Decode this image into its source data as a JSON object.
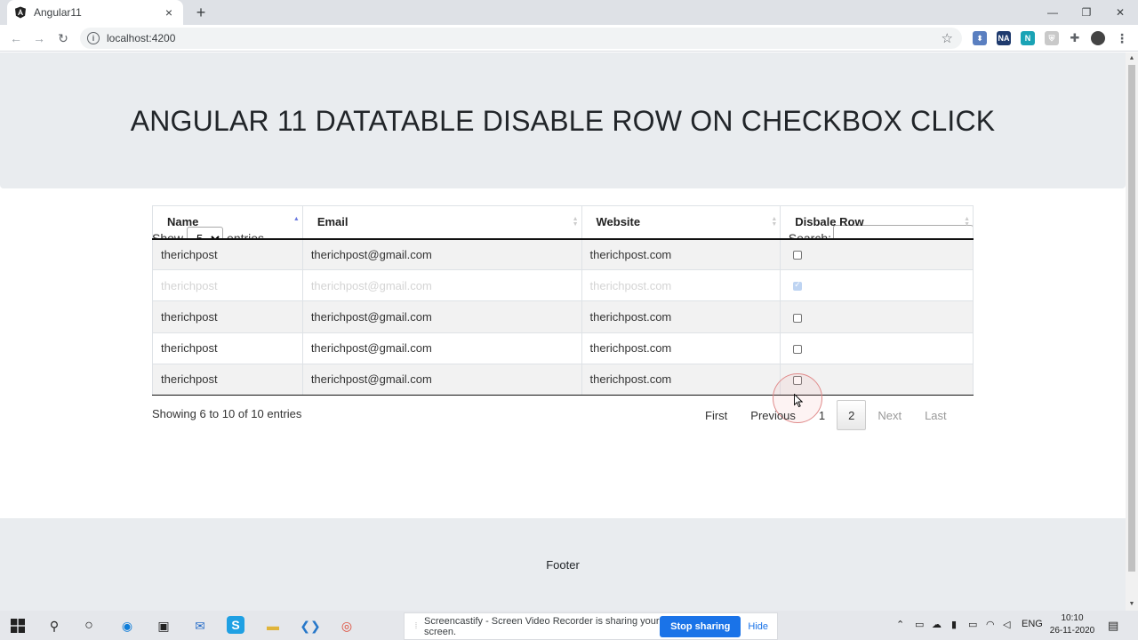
{
  "browser": {
    "tab_title": "Angular11",
    "tab_close": "×",
    "new_tab": "+",
    "url": "localhost:4200",
    "window_controls": {
      "minimize": "—",
      "maximize": "❐",
      "close": "✕"
    },
    "extensions": [
      "account-icon",
      "na-extension-icon",
      "n-extension-icon",
      "shield-extension-icon",
      "puzzle-extensions-icon",
      "profile-avatar-icon"
    ],
    "ext_na_label": "NA",
    "ext_n_label": "N"
  },
  "page": {
    "title": "ANGULAR 11 DATATABLE DISABLE ROW ON CHECKBOX CLICK",
    "show_label": "Show",
    "entries_label": "entries",
    "page_length": "5",
    "page_length_options": [
      "5"
    ],
    "search_label": "Search:",
    "search_value": "",
    "columns": [
      "Name",
      "Email",
      "Website",
      "Disbale Row"
    ],
    "rows": [
      {
        "name": "therichpost",
        "email": "therichpost@gmail.com",
        "website": "therichpost.com",
        "checked": false,
        "disabled": false
      },
      {
        "name": "therichpost",
        "email": "therichpost@gmail.com",
        "website": "therichpost.com",
        "checked": true,
        "disabled": true
      },
      {
        "name": "therichpost",
        "email": "therichpost@gmail.com",
        "website": "therichpost.com",
        "checked": false,
        "disabled": false
      },
      {
        "name": "therichpost",
        "email": "therichpost@gmail.com",
        "website": "therichpost.com",
        "checked": false,
        "disabled": false
      },
      {
        "name": "therichpost",
        "email": "therichpost@gmail.com",
        "website": "therichpost.com",
        "checked": false,
        "disabled": false
      }
    ],
    "info": "Showing 6 to 10 of 10 entries",
    "pagination": {
      "first": "First",
      "previous": "Previous",
      "page1": "1",
      "page2": "2",
      "next": "Next",
      "last": "Last"
    },
    "footer": "Footer"
  },
  "share_banner": {
    "message": "Screencastify - Screen Video Recorder is sharing your screen.",
    "stop": "Stop sharing",
    "hide": "Hide"
  },
  "taskbar": {
    "language": "ENG",
    "time": "10:10",
    "date": "26-11-2020"
  },
  "colors": {
    "jumbotron": "#e9ecef",
    "stop_button": "#1a73e8",
    "checked_checkbox": "#a9c6ee"
  }
}
